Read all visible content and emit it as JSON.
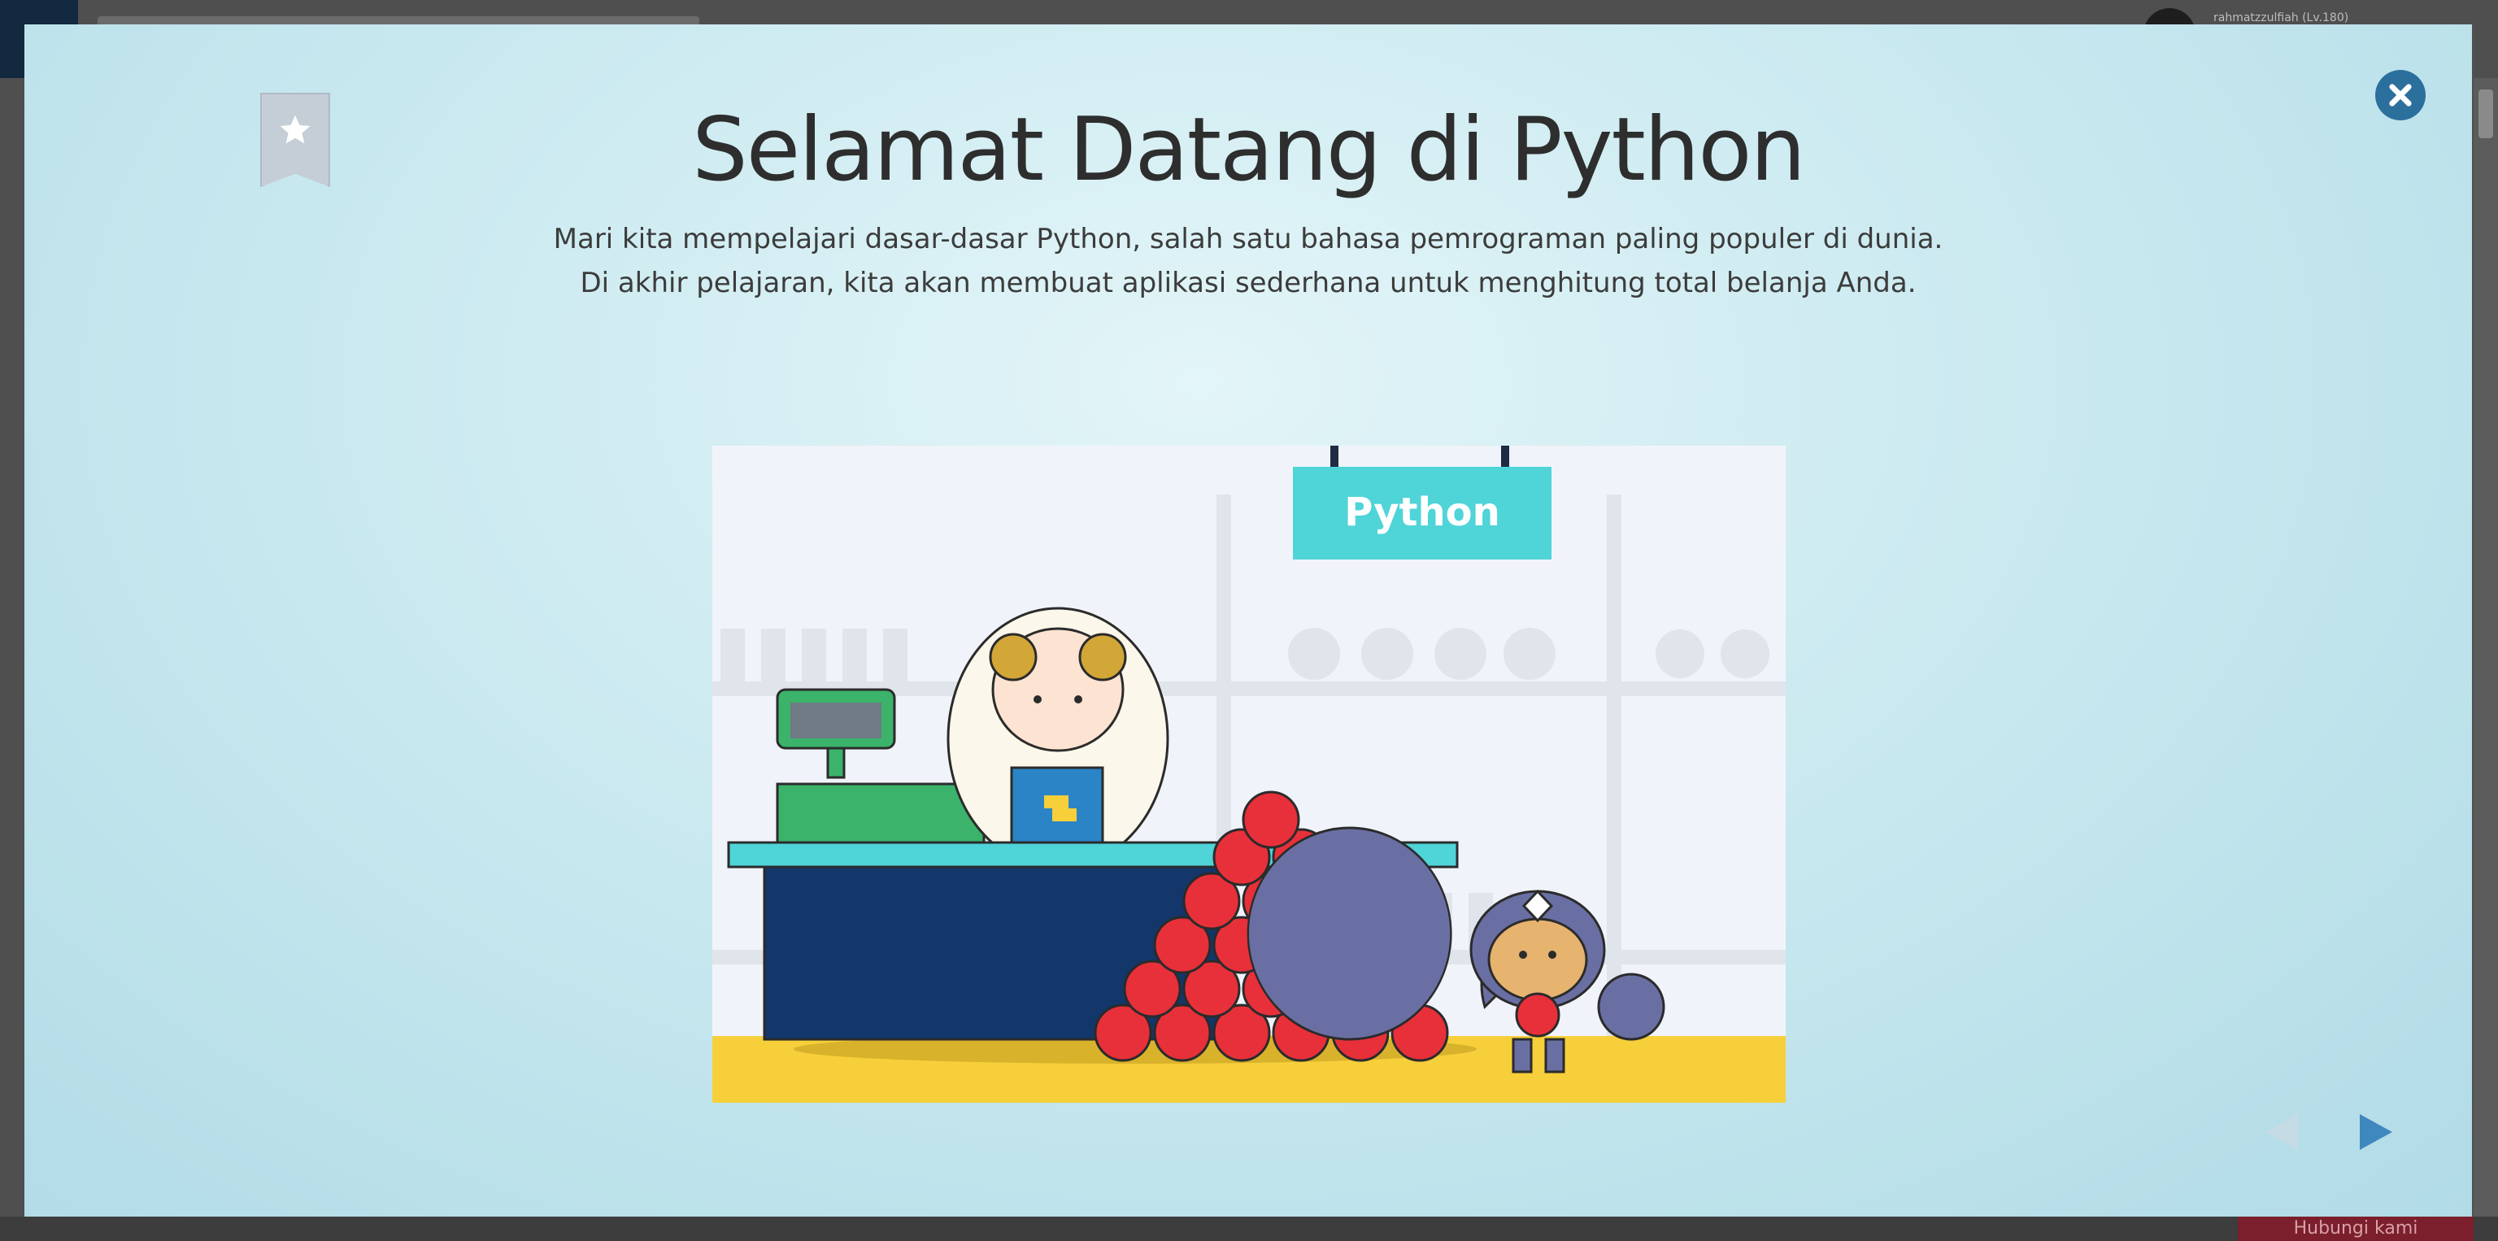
{
  "background": {
    "username": "rahmatzzulfiah (Lv.180)",
    "cta_label": "Hubungi kami"
  },
  "modal": {
    "title": "Selamat Datang di Python",
    "description_line1": "Mari kita mempelajari dasar-dasar Python, salah satu bahasa pemrograman paling populer di dunia.",
    "description_line2": "Di akhir pelajaran, kita akan membuat aplikasi sederhana untuk menghitung total belanja Anda.",
    "illustration": {
      "sign_text": "Python"
    },
    "icons": {
      "bookmark": "bookmark-star-icon",
      "close": "close-icon",
      "prev": "triangle-left-icon",
      "next": "triangle-right-icon"
    },
    "colors": {
      "accent": "#2b6f9d",
      "sign": "#4fd4d8",
      "counter": "#13376a",
      "apple": "#e8303a",
      "floor": "#f6cf3a"
    }
  }
}
